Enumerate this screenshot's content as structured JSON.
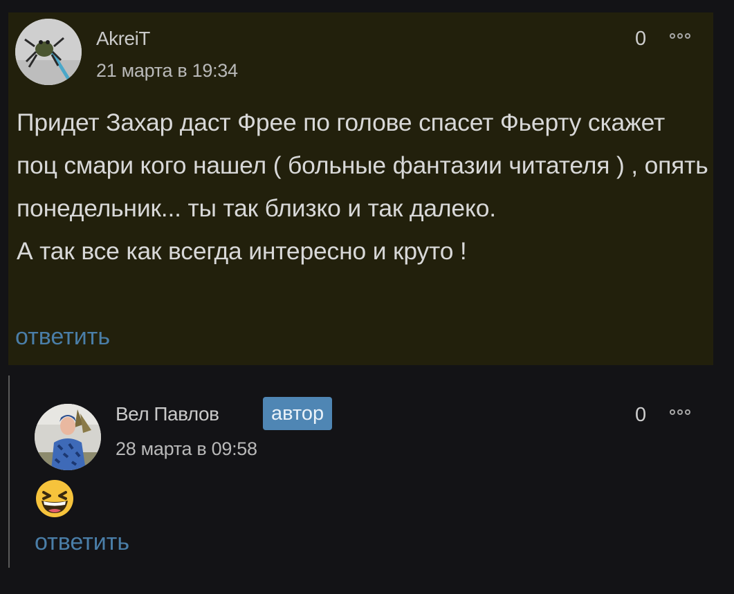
{
  "comments": [
    {
      "author": "AkreiT",
      "date": "21 марта в 19:34",
      "rating": "0",
      "body": [
        "Придет Захар даст Фрее по голове спасет Фьерту скажет поц смари кого нашел ( больные фантазии читателя ) , опять понедельник... ты так близко и так далеко.",
        "А так все как всегда интересно и круто !"
      ],
      "reply_label": "ответить"
    },
    {
      "author": "Вел Павлов",
      "badge": "автор",
      "date": "28 марта в 09:58",
      "rating": "0",
      "emoji": "laughing-face",
      "reply_label": "ответить"
    }
  ],
  "colors": {
    "highlight_bg": "#22200c",
    "page_bg": "#131316",
    "link": "#4a7ea8",
    "badge": "#4f86b4"
  }
}
